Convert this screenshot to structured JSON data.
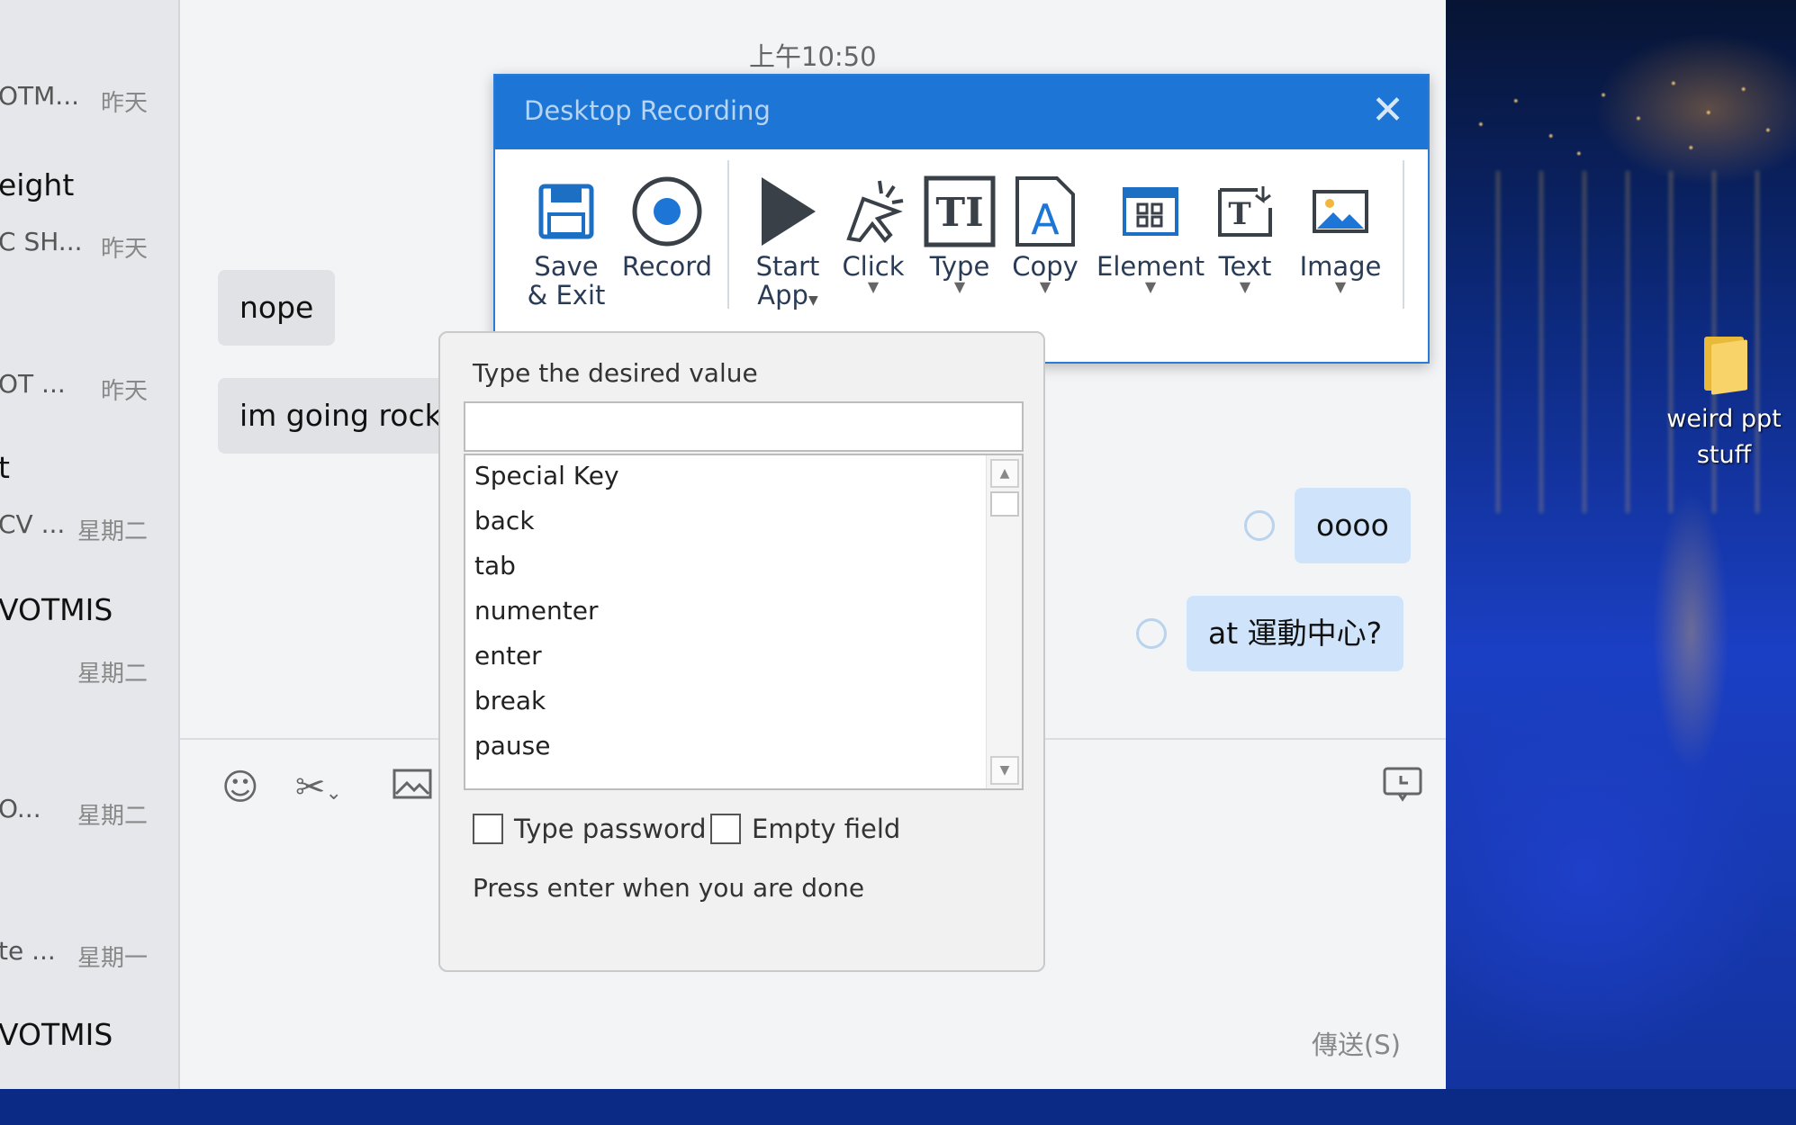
{
  "desktop": {
    "icon_label": "weird ppt stuff"
  },
  "chat_list": [
    {
      "name": "",
      "snippet": "OTM...",
      "time": "昨天"
    },
    {
      "name": "eight",
      "snippet": "C SH...",
      "time": "昨天"
    },
    {
      "name": "",
      "snippet": "OT  ...",
      "time": "昨天"
    },
    {
      "name": "t",
      "snippet": "CV ...",
      "time": "星期二"
    },
    {
      "name": "VOTMIS",
      "snippet": "",
      "time": "星期二"
    },
    {
      "name": "",
      "snippet": "O...",
      "time": "星期二"
    },
    {
      "name": "",
      "snippet": "te ...",
      "time": "星期一"
    },
    {
      "name": "VOTMIS",
      "snippet": "",
      "time": ""
    }
  ],
  "messages": {
    "timestamp": "上午10:50",
    "items": [
      {
        "text": "nope",
        "direction": "in"
      },
      {
        "text": "im going rocking",
        "direction": "in"
      },
      {
        "text": "oooo",
        "direction": "out"
      },
      {
        "text": "at 運動中心?",
        "direction": "out"
      }
    ]
  },
  "compose": {
    "send_label": "傳送(S)",
    "tools": [
      "emoji-icon",
      "scissors-icon",
      "image-icon",
      "history-icon"
    ]
  },
  "recorder": {
    "title": "Desktop Recording",
    "close_glyph": "✕",
    "buttons": [
      {
        "label_1": "Save",
        "label_2": "& Exit",
        "icon": "save-icon"
      },
      {
        "label_1": "Record",
        "label_2": "",
        "icon": "record-icon"
      },
      {
        "label_1": "Start",
        "label_2": "App",
        "icon": "play-icon"
      },
      {
        "label_1": "Click",
        "label_2": "",
        "icon": "click-icon"
      },
      {
        "label_1": "Type",
        "label_2": "",
        "icon": "type-icon"
      },
      {
        "label_1": "Copy",
        "label_2": "",
        "icon": "copy-icon"
      },
      {
        "label_1": "Element",
        "label_2": "",
        "icon": "element-icon"
      },
      {
        "label_1": "Text",
        "label_2": "",
        "icon": "text-icon"
      },
      {
        "label_1": "Image",
        "label_2": "",
        "icon": "image-icon"
      }
    ]
  },
  "type_popup": {
    "hint": "Type the desired value",
    "input_value": "",
    "options": [
      "Special Key",
      "back",
      "tab",
      "numenter",
      "enter",
      "break",
      "pause"
    ],
    "type_password_label": "Type password",
    "empty_field_label": "Empty field",
    "done_hint": "Press enter when you are done"
  },
  "colors": {
    "accent": "#1d76d5",
    "outgoing_bubble": "#cfe4fb",
    "incoming_bubble": "#e1e2e5"
  }
}
